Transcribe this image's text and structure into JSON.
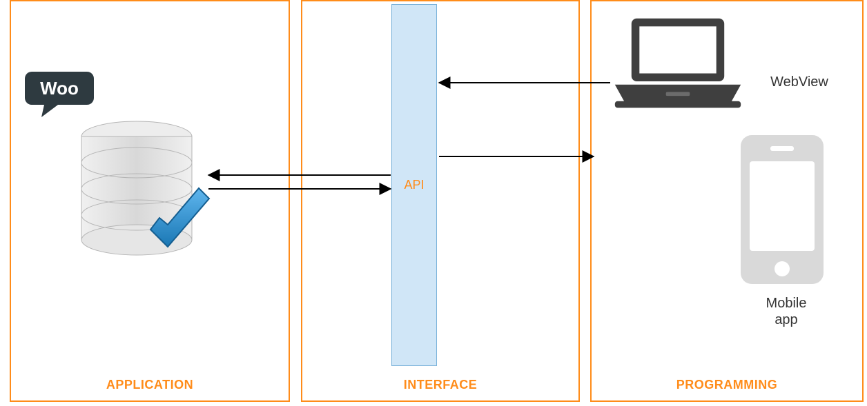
{
  "panels": {
    "application": {
      "label": "APPLICATION"
    },
    "interface": {
      "label": "INTERFACE"
    },
    "programming": {
      "label": "PROGRAMMING"
    }
  },
  "api_label": "API",
  "woo_label": "Woo",
  "devices": {
    "webview": "WebView",
    "mobile_line1": "Mobile",
    "mobile_line2": "app"
  },
  "colors": {
    "accent": "#FF8C1A",
    "api_fill": "#D0E6F7",
    "api_stroke": "#7BB3DB",
    "dark": "#3F3F3F",
    "light_grey": "#D9D9D9",
    "check_blue": "#2A8FD1"
  }
}
